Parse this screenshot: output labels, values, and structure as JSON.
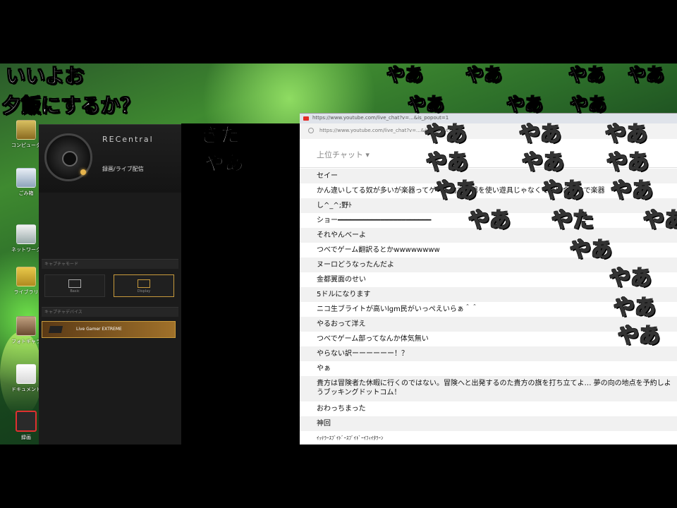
{
  "rec_app": {
    "logo": "RECentral",
    "mode_label": "録画/ライブ配信",
    "section1": "キャプチャモード",
    "tiles": [
      "Basic",
      "Display"
    ],
    "section2": "キャプチャデバイス",
    "device": "Live Gamer EXTREME"
  },
  "browser": {
    "tab_title": "https://www.youtube.com/live_chat?v=...&is_popout=1",
    "url": "https://www.youtube.com/live_chat?v=...&is_popout=1",
    "chat_mode": "上位チャット ▾"
  },
  "chat_messages": [
    "セイー",
    "かん違いしてる奴が多いが楽器ってゲーム内で楽器を使い遊具じゃなくて言い合わせで楽器",
    "し^_^;野ﾄ",
    "ショー━━━━━━━━━━━━━━━━━━━━━━",
    "それやんべーよ",
    "つべでゲーム翻訳るとかwwwwwwww",
    "ヌーロどうなったんだよ",
    "金都翼面のせい",
    "5ドルになります",
    "ニコ生ブライトが高いlgm民がいっぺえいらぁ＾＾",
    "やるおって洋え",
    "つべでゲーム部ってなんか体気無い",
    "やらない訳ーーーーーー！？",
    "やぁ",
    "貴方は冒険者た休暇に行くのではない。冒険へと出発するのた貴方の旗を打ち立てよ… 夢の向の地点を予約しようブッキングドットコム！",
    "おわっちまった",
    "神回",
    "ｲｯﾃﾗｰｽﾌﾞｲﾄﾞｰｽﾌﾞｲﾄﾞｰｲﾌｨｲﾀﾗｰﾝ"
  ],
  "overlay_comments": [
    "いいよお",
    "夕飯にするか？",
    "きた",
    "やあ",
    "やあ",
    "やあ",
    "やあ",
    "やあ",
    "やあ",
    "やあ",
    "やあ",
    "やあ",
    "やあ",
    "やあ",
    "やあ",
    "やあ",
    "やあ",
    "やあ",
    "やあ",
    "やあ",
    "やあ",
    "やた",
    "やあ",
    "やあ",
    "やあ",
    "やあ",
    "やあ"
  ],
  "desktop_icons": [
    "コンピュータ",
    "ごみ箱",
    "ネットワーク",
    "ライブラリ",
    "フォトギャラリー",
    "ドキュメント",
    "録画"
  ]
}
